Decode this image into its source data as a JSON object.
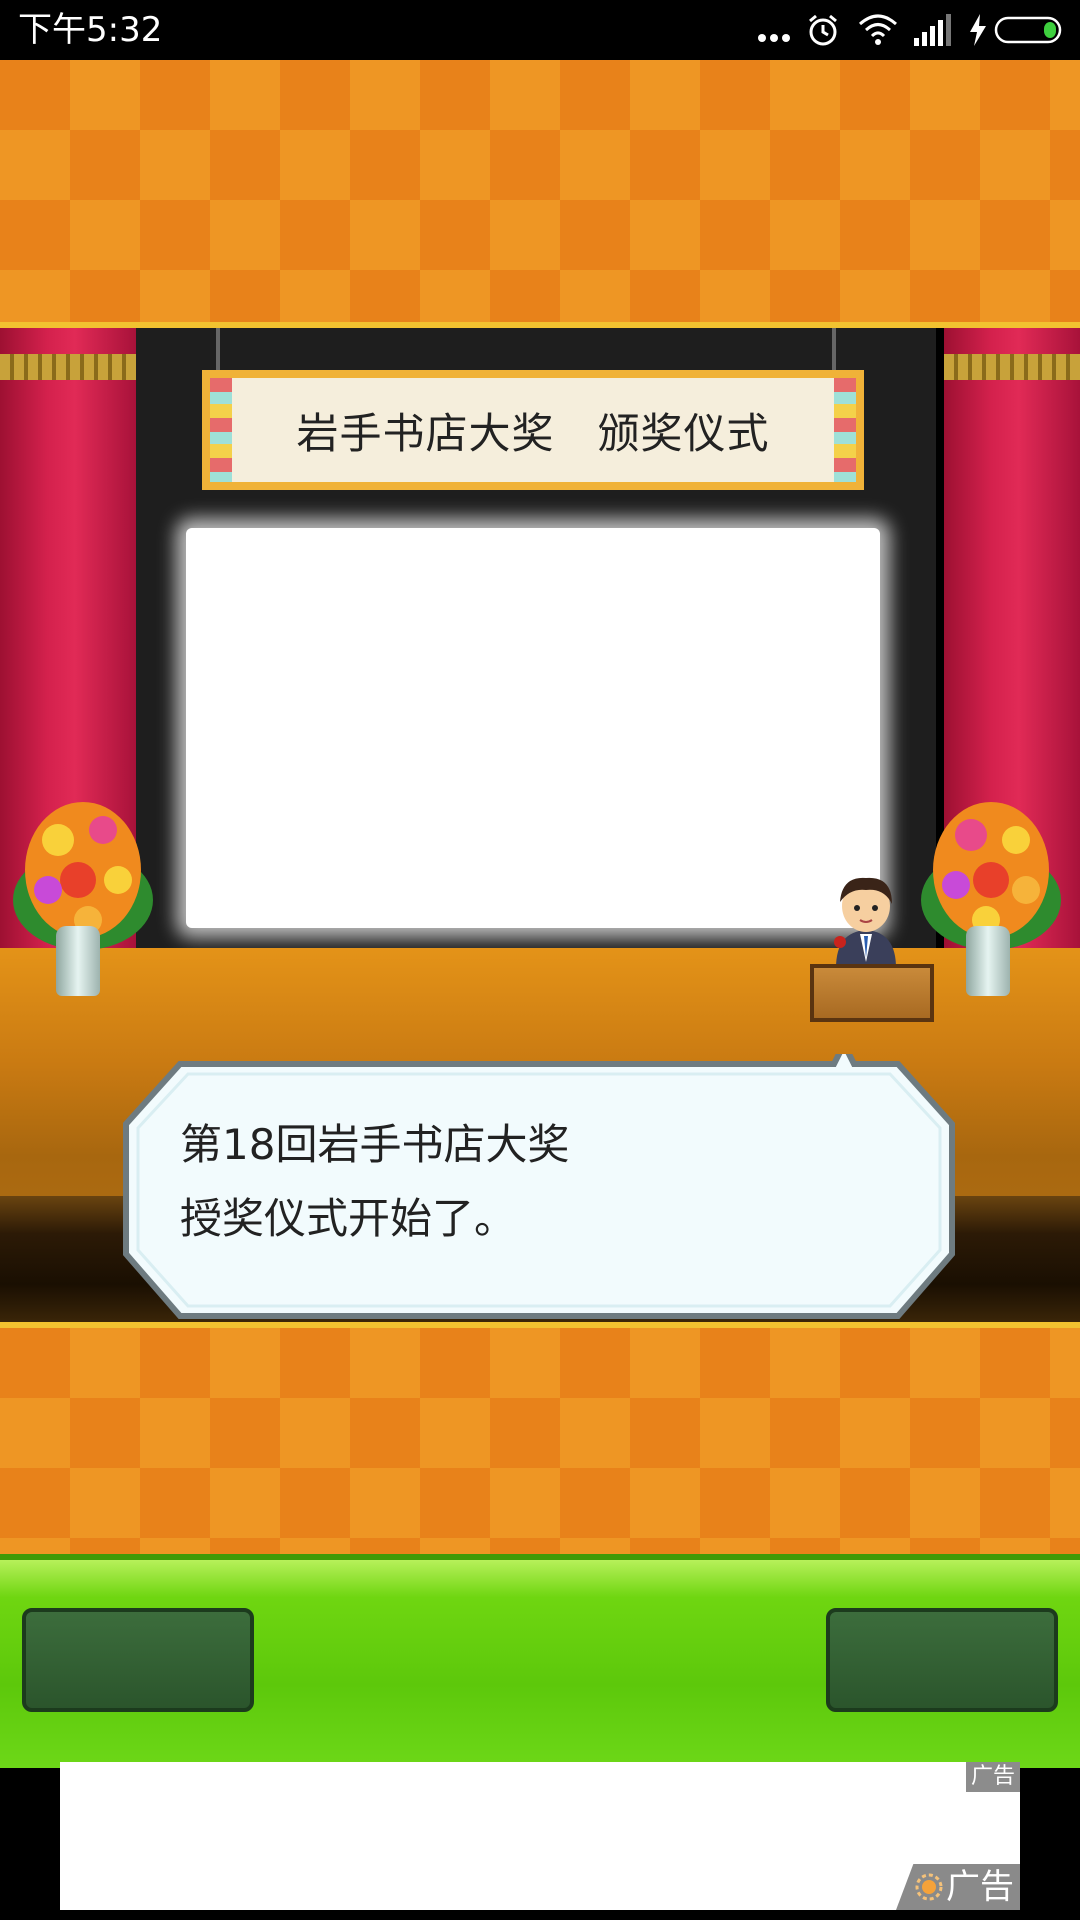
{
  "status_bar": {
    "time": "下午5:32",
    "icons": [
      "more-dots-icon",
      "alarm-icon",
      "wifi-icon",
      "signal-icon",
      "charging-icon",
      "battery-icon"
    ]
  },
  "stage": {
    "sign_title": "岩手书店大奖　颁奖仪式",
    "decorations": [
      "curtain",
      "flower-vase",
      "presenter-at-podium"
    ]
  },
  "dialog": {
    "text": "第18回岩手书店大奖\n授奖仪式开始了。"
  },
  "controls": {
    "left_button_label": "",
    "right_button_label": ""
  },
  "ad": {
    "badge_label": "广告",
    "corner_label": "广告"
  },
  "colors": {
    "checker_orange": "#e8821a",
    "accent_gold": "#f2c230",
    "curtain_red": "#d4214d",
    "control_green": "#5dc80b",
    "button_dark_green": "#2b552c"
  }
}
